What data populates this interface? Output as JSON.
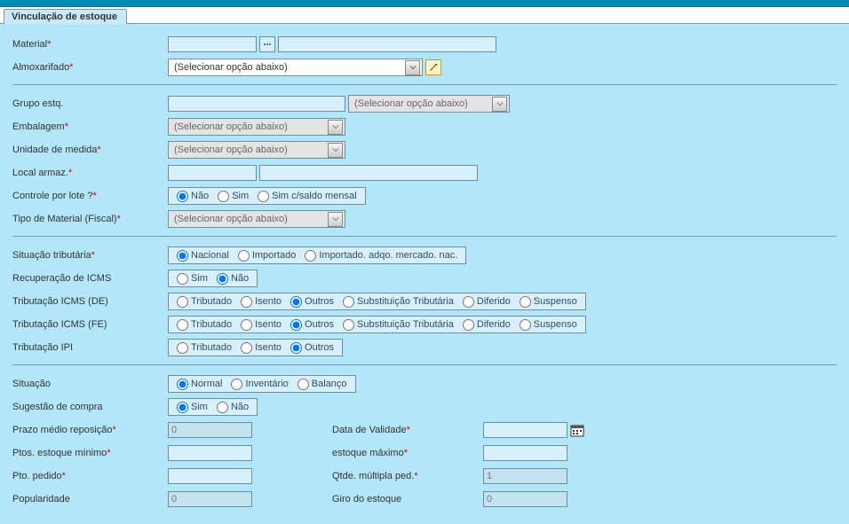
{
  "tab": {
    "title": "Vinculação de estoque"
  },
  "labels": {
    "material": "Material",
    "almoxarifado": "Almoxarifado",
    "grupo_estq": "Grupo estq.",
    "embalagem": "Embalagem",
    "unidade_medida": "Unidade de medida",
    "local_armaz": "Local armaz.",
    "controle_lote": "Controle por lote ?",
    "tipo_material_fiscal": "Tipo de Material (Fiscal)",
    "situacao_tributaria": "Situação tributária",
    "recuperacao_icms": "Recuperação de ICMS",
    "tributacao_icms_de": "Tributação ICMS (DE)",
    "tributacao_icms_fe": "Tributação ICMS (FE)",
    "tributacao_ipi": "Tributação IPI",
    "situacao": "Situação",
    "sugestao_compra": "Sugestão de compra",
    "prazo_medio": "Prazo médio reposição",
    "data_validade": "Data de Validade",
    "ptos_estoque_min": "Ptos. estoque mínimo",
    "estoque_maximo": "estoque máximo",
    "pto_pedido": "Pto. pedido",
    "qtde_multipla": "Qtde. múltipla ped.",
    "popularidade": "Popularidade",
    "giro_estoque": "Giro do estoque"
  },
  "placeholders": {
    "select_default": "(Selecionar opção abaixo)"
  },
  "radios": {
    "controle_lote": {
      "opts": [
        "Não",
        "Sim",
        "Sim c/saldo mensal"
      ],
      "selected": 0
    },
    "situacao_tributaria": {
      "opts": [
        "Nacional",
        "Importado",
        "Importado. adqo. mercado. nac."
      ],
      "selected": 0
    },
    "recuperacao_icms": {
      "opts": [
        "Sim",
        "Não"
      ],
      "selected": 1
    },
    "tributacao_icms_de": {
      "opts": [
        "Tributado",
        "Isento",
        "Outros",
        "Substituição Tributária",
        "Diferido",
        "Suspenso"
      ],
      "selected": 2
    },
    "tributacao_icms_fe": {
      "opts": [
        "Tributado",
        "Isento",
        "Outros",
        "Substituição Tributária",
        "Diferido",
        "Suspenso"
      ],
      "selected": 2
    },
    "tributacao_ipi": {
      "opts": [
        "Tributado",
        "Isento",
        "Outros"
      ],
      "selected": 2
    },
    "situacao": {
      "opts": [
        "Normal",
        "Inventário",
        "Balanço"
      ],
      "selected": 0
    },
    "sugestao_compra": {
      "opts": [
        "Sim",
        "Não"
      ],
      "selected": 0
    }
  },
  "values": {
    "material_code": "",
    "material_desc": "",
    "grupo_estq": "",
    "local_armaz_code": "",
    "local_armaz_desc": "",
    "prazo_medio": "0",
    "data_validade": "",
    "ptos_estoque_min": "",
    "estoque_maximo": "",
    "pto_pedido": "",
    "qtde_multipla": "1",
    "popularidade": "0",
    "giro_estoque": "0"
  }
}
